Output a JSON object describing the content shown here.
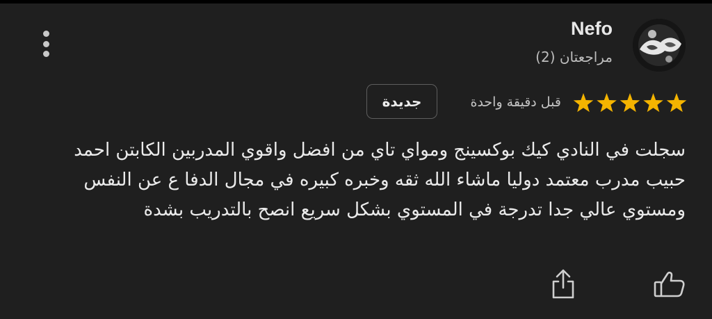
{
  "reviewer": {
    "name": "Nefo",
    "review_count": "مراجعتان (2)"
  },
  "rating": {
    "stars": 5,
    "max": 5,
    "star_color": "#f4b400"
  },
  "time_ago": "قبل دقيقة واحدة",
  "badge": {
    "label": "جديدة"
  },
  "review": {
    "text": "سجلت في النادي كيك بوكسينج ومواي تاي من افضل واقوي المدربين الكابتن احمد حبيب مدرب معتمد دوليا ماشاء الله ثقه وخبره كبيره في مجال الدفا ع عن النفس ومستوي عالي جدا تدرجة في المستوي بشكل سريع انصح بالتدريب بشدة"
  },
  "actions": {
    "share_icon": "share-icon",
    "like_icon": "thumbs-up-icon",
    "more_icon": "more-vertical-icon"
  },
  "colors": {
    "background": "#1f1f1f",
    "text": "#ebebeb",
    "muted": "#bdbdbd",
    "badge_border": "#5e5e5e"
  }
}
